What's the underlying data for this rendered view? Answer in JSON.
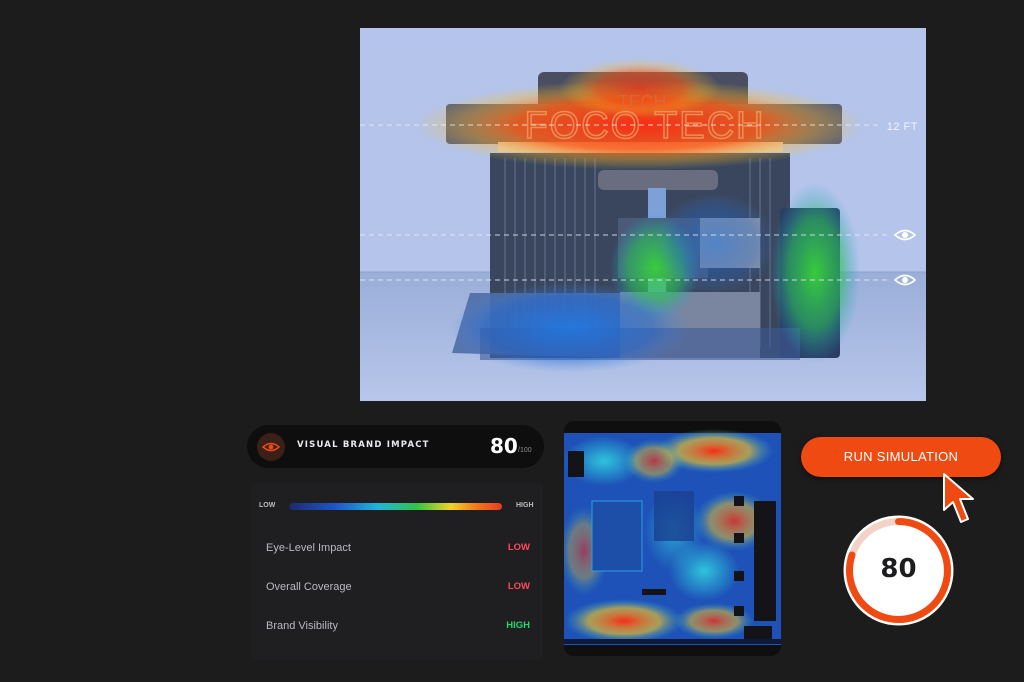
{
  "render": {
    "sign_text_top": "TECH",
    "sign_text_main": "FOCO TECH",
    "height_marker_label": "12 FT",
    "eye_markers": [
      "eye-icon",
      "eye-icon"
    ]
  },
  "impact": {
    "icon": "eye-icon",
    "title": "VISUAL BRAND IMPACT",
    "score": "80",
    "score_max": "/100"
  },
  "scale": {
    "low_label": "LOW",
    "high_label": "HIGH"
  },
  "metrics": [
    {
      "name": "Eye-Level Impact",
      "value": "LOW",
      "color": "#ff4a5c"
    },
    {
      "name": "Overall Coverage",
      "value": "LOW",
      "color": "#ff4a5c"
    },
    {
      "name": "Brand Visibility",
      "value": "HIGH",
      "color": "#2bd46b"
    }
  ],
  "actions": {
    "run_label": "RUN SIMULATION"
  },
  "result": {
    "score": "80",
    "fraction": 0.8
  },
  "colors": {
    "accent": "#ee4a12",
    "background": "#1c1c1d",
    "low": "#ff4a5c",
    "high": "#2bd46b"
  }
}
